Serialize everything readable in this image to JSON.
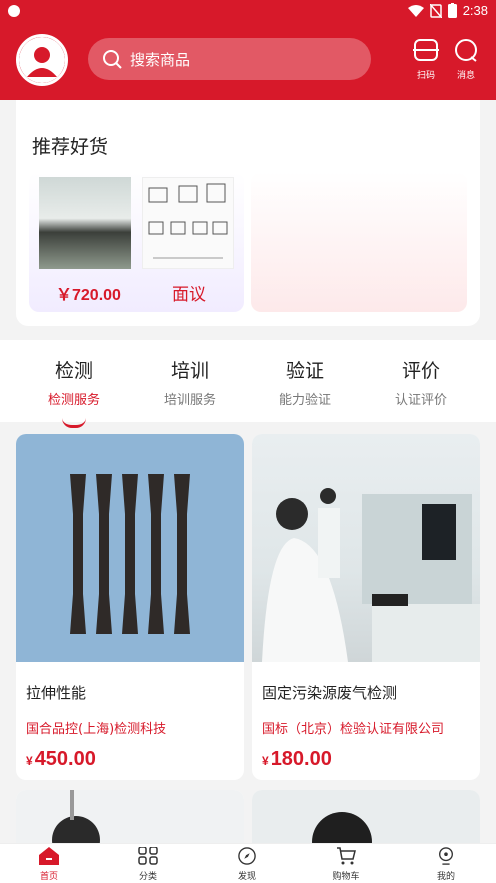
{
  "status_bar": {
    "time": "2:38"
  },
  "header": {
    "search_placeholder": "搜索商品",
    "scan_label": "扫码",
    "message_label": "消息",
    "brand_color": "#d7192a"
  },
  "recommend": {
    "title": "推荐好货",
    "items": [
      {
        "price": "￥720.00"
      },
      {
        "price": "面议"
      }
    ]
  },
  "tabs": [
    {
      "title": "检测",
      "subtitle": "检测服务",
      "active": true
    },
    {
      "title": "培训",
      "subtitle": "培训服务",
      "active": false
    },
    {
      "title": "验证",
      "subtitle": "能力验证",
      "active": false
    },
    {
      "title": "评价",
      "subtitle": "认证评价",
      "active": false
    }
  ],
  "products": [
    {
      "name": "拉伸性能",
      "shop": "国合品控(上海)检测科技",
      "currency": "¥",
      "price": "450.00"
    },
    {
      "name": "固定污染源废气检测",
      "shop": "国标（北京）检验认证有限公司",
      "currency": "¥",
      "price": "180.00"
    }
  ],
  "bottom_nav": [
    {
      "label": "首页",
      "icon": "home-icon",
      "active": true
    },
    {
      "label": "分类",
      "icon": "grid-icon",
      "active": false
    },
    {
      "label": "发现",
      "icon": "compass-icon",
      "active": false
    },
    {
      "label": "购物车",
      "icon": "cart-icon",
      "active": false
    },
    {
      "label": "我的",
      "icon": "user-icon",
      "active": false
    }
  ]
}
